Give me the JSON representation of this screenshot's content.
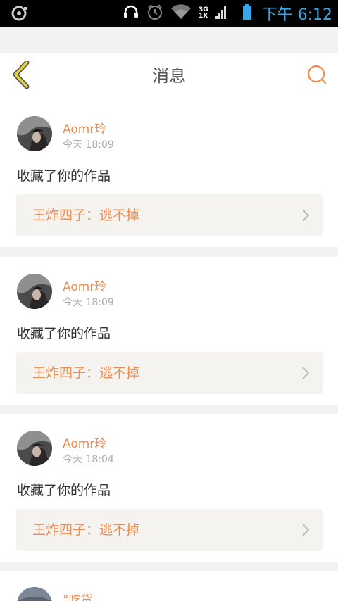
{
  "status_bar": {
    "network_top": "3G",
    "network_bottom": "1X",
    "time": "下午 6:12",
    "icons": [
      "notification-icon",
      "headset-icon",
      "alarm-icon",
      "wifi-icon",
      "signal-icon",
      "battery-icon"
    ]
  },
  "header": {
    "title": "消息",
    "back_icon": "chevron-left-icon",
    "search_icon": "search-icon"
  },
  "messages": [
    {
      "user": "Aomr玲",
      "time": "今天 18:09",
      "action": "收藏了你的作品",
      "work_title": "王炸四子：逃不掉"
    },
    {
      "user": "Aomr玲",
      "time": "今天 18:09",
      "action": "收藏了你的作品",
      "work_title": "王炸四子：逃不掉"
    },
    {
      "user": "Aomr玲",
      "time": "今天 18:04",
      "action": "收藏了你的作品",
      "work_title": "王炸四子：逃不掉"
    },
    {
      "user": "°吃货"
    }
  ],
  "colors": {
    "accent": "#f08b4e",
    "back_arrow": "#e8d23c",
    "clock": "#39a7e6"
  }
}
